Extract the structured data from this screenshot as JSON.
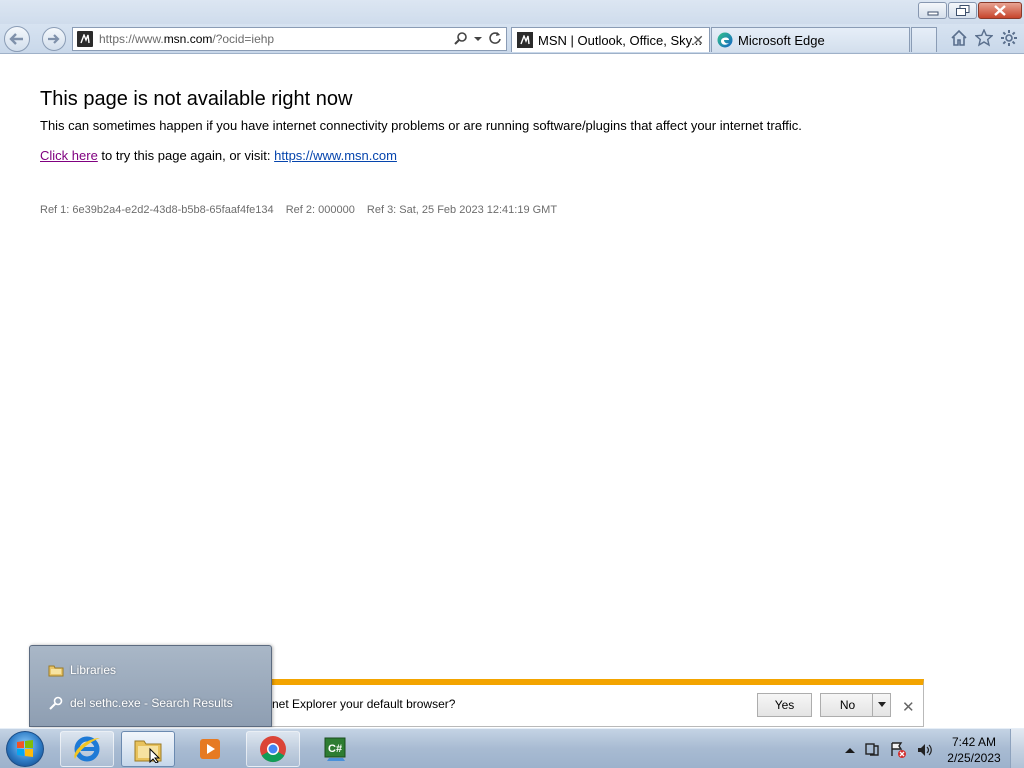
{
  "browser": {
    "address": {
      "prefix": "https://www.",
      "domain": "msn.com",
      "suffix": "/?ocid=iehp"
    },
    "tabs": [
      {
        "label": "MSN | Outlook, Office, Sky...",
        "active": true
      },
      {
        "label": "Microsoft Edge",
        "active": false
      }
    ],
    "icons": [
      "back-icon",
      "forward-icon",
      "search-icon",
      "dropdown-icon",
      "refresh-icon",
      "home-icon",
      "favorites-star-icon",
      "settings-gear-icon"
    ]
  },
  "page": {
    "title": "This page is not available right now",
    "description": "This can sometimes happen if you have internet connectivity problems or are running software/plugins that affect your internet traffic.",
    "retry_link": "Click here",
    "retry_text": " to try this page again, or visit: ",
    "msn_link": "https://www.msn.com",
    "refs": {
      "ref1": "Ref 1: 6e39b2a4-e2d2-43d8-b5b8-65faaf4fe134",
      "ref2": "Ref 2: 000000",
      "ref3": "Ref 3: Sat, 25 Feb 2023 12:41:19 GMT"
    }
  },
  "notification": {
    "text": "net Explorer your default browser?",
    "yes_label": "Yes",
    "no_label": "No"
  },
  "jumplist": {
    "items": [
      {
        "label": "Libraries",
        "icon": "libraries-folder-icon"
      },
      {
        "label": "del sethc.exe - Search Results",
        "icon": "search-results-icon"
      }
    ]
  },
  "taskbar": {
    "apps": [
      "internet-explorer",
      "windows-explorer",
      "media-player",
      "chrome",
      "csharp-editor"
    ],
    "clock_time": "7:42 AM",
    "clock_date": "2/25/2023"
  },
  "colors": {
    "notif_accent": "#f3a400",
    "link_visited": "#800080",
    "link": "#0645ad"
  }
}
